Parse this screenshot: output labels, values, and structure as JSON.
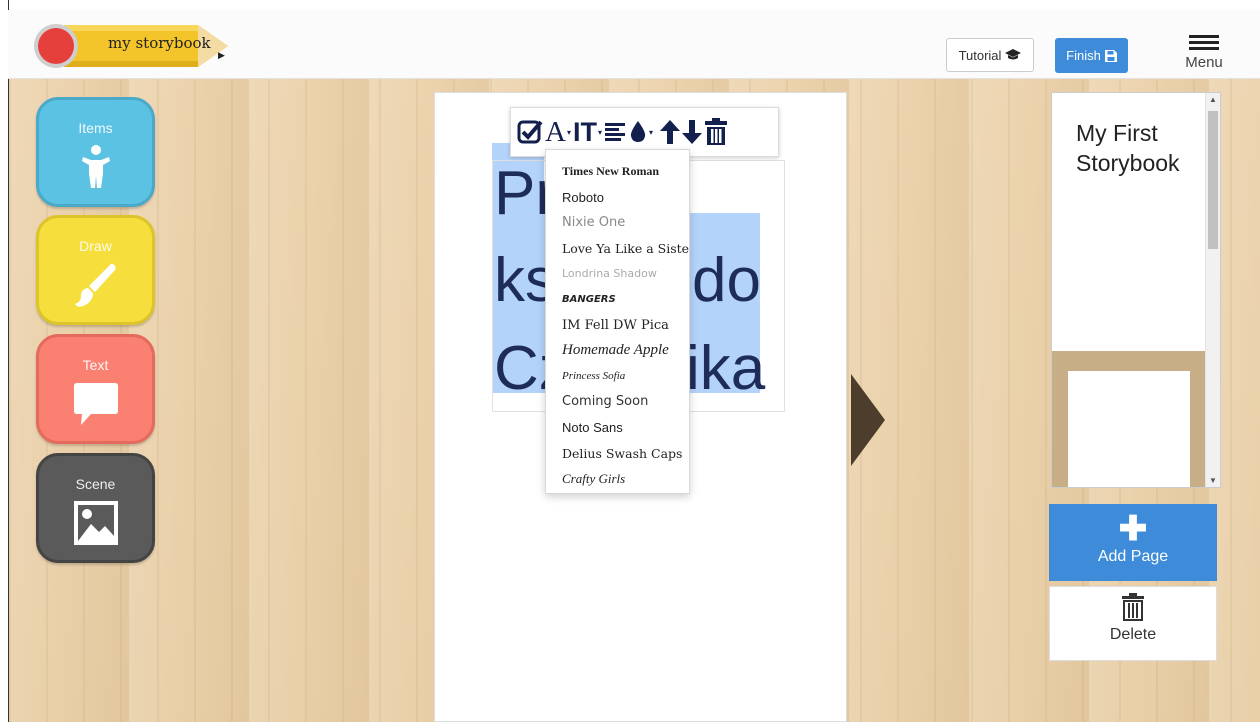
{
  "app": {
    "logo_text": "my storybook"
  },
  "header": {
    "tutorial_label": "Tutorial",
    "finish_label": "Finish",
    "menu_label": "Menu"
  },
  "tools": [
    {
      "label": "Items",
      "icon": "child-icon",
      "color": "#5bc2e4"
    },
    {
      "label": "Draw",
      "icon": "brush-icon",
      "color": "#f6de3c"
    },
    {
      "label": "Text",
      "icon": "speech-bubble-icon",
      "color": "#fa8172"
    },
    {
      "label": "Scene",
      "icon": "image-icon",
      "color": "#5a5a5a"
    }
  ],
  "canvas": {
    "text_lines": [
      "Pr",
      "ks",
      "do",
      "Cz",
      "ika"
    ],
    "toolbar": [
      "check-icon",
      "font-icon",
      "text-size-icon",
      "align-icon",
      "color-drop-icon",
      "move-up-icon",
      "move-down-icon",
      "trash-icon"
    ]
  },
  "font_menu": {
    "items": [
      "Times New Roman",
      "Roboto",
      "Nixie One",
      "Love Ya Like a Sister",
      "Londrina Shadow",
      "BANGERS",
      "IM Fell DW Pica",
      "Homemade Apple",
      "Princess Sofia",
      "Coming Soon",
      "Noto Sans",
      "Delius Swash Caps",
      "Crafty Girls"
    ]
  },
  "pages_panel": {
    "title": "My First Storybook",
    "add_page_label": "Add Page",
    "delete_label": "Delete"
  },
  "colors": {
    "accent_blue": "#3d8bd9",
    "text_dark_navy": "#1d2c58",
    "selection": "#b4d3fb",
    "wood": "#e8cea6"
  }
}
